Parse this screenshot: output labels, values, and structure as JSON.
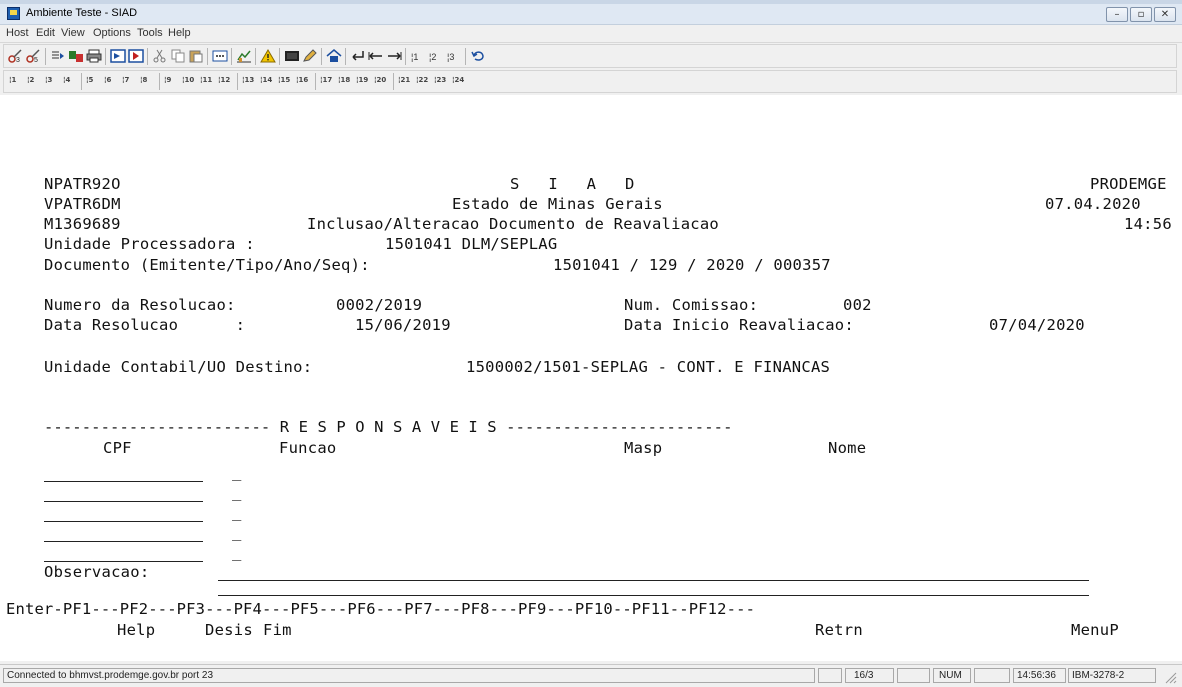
{
  "window": {
    "title": "Ambiente Teste - SIAD"
  },
  "menu": [
    "Host",
    "Edit",
    "View",
    "Options",
    "Tools",
    "Help"
  ],
  "pf_keys": [
    "1",
    "2",
    "3",
    "4",
    "5",
    "6",
    "7",
    "8",
    "9",
    "10",
    "11",
    "12",
    "13",
    "14",
    "15",
    "16",
    "17",
    "18",
    "19",
    "20",
    "21",
    "22",
    "23",
    "24"
  ],
  "screen": {
    "program": "NPATR92O",
    "system_title": "S   I   A   D",
    "company": "PRODEMGE",
    "view": "VPATR6DM",
    "state": "Estado de Minas Gerais",
    "date": "07.04.2020",
    "user": "M1369689",
    "screen_title": "Inclusao/Alteracao Documento de Reavaliacao",
    "time": "14:56",
    "unidade_label": "Unidade Processadora :",
    "unidade_value": "1501041 DLM/SEPLAG",
    "documento_label": "Documento (Emitente/Tipo/Ano/Seq):",
    "documento_value": "1501041 / 129 / 2020 / 000357",
    "resolucao_label": "Numero da Resolucao:",
    "resolucao_value": "0002/2019",
    "comissao_label": "Num. Comissao:",
    "comissao_value": "002",
    "data_resolucao_label": "Data Resolucao      :",
    "data_resolucao_value": "15/06/2019",
    "data_inicio_label": "Data Inicio Reavaliacao:",
    "data_inicio_value": "07/04/2020",
    "destino_label": "Unidade Contabil/UO Destino:",
    "destino_value": "1500002/1501-SEPLAG - CONT. E FINANCAS",
    "responsaveis_line": "------------------------ R E S P O N S A V E I S ------------------------",
    "col_cpf": "CPF",
    "col_funcao": "Funcao",
    "col_masp": "Masp",
    "col_nome": "Nome",
    "funcao_placeholder": "_",
    "observacao_label": "Observacao:",
    "pf_line": "Enter-PF1---PF2---PF3---PF4---PF5---PF6---PF7---PF8---PF9---PF10--PF11--PF12---",
    "pf_help": "Help",
    "pf_desis": "Desis",
    "pf_fim": "Fim",
    "pf_retrn": "Retrn",
    "pf_menup": "MenuP"
  },
  "status": {
    "connection": "Connected to bhmvst.prodemge.gov.br port 23",
    "cursor": "16/3",
    "num": "NUM",
    "clock": "14:56:36",
    "terminal": "IBM-3278-2"
  }
}
